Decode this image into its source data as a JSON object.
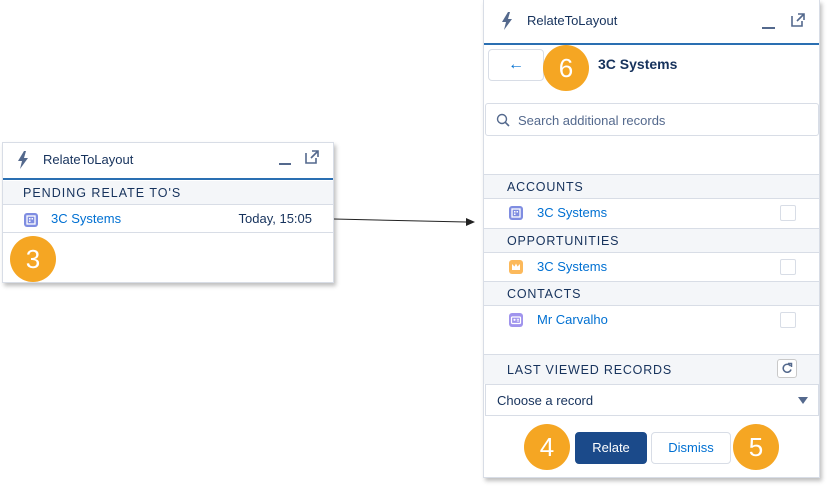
{
  "colors": {
    "accent": "#2a6fb2",
    "link": "#0070d2",
    "badge": "#f5a623",
    "primary_button": "#1b4a8a"
  },
  "left_panel": {
    "title": "RelateToLayout",
    "section": "PENDING RELATE TO'S",
    "item": {
      "name": "3C Systems",
      "time": "Today, 15:05",
      "icon": "account-icon"
    }
  },
  "badges": {
    "b3": "3",
    "b4": "4",
    "b5": "5",
    "b6": "6"
  },
  "right_panel": {
    "title": "RelateToLayout",
    "back_label": "←",
    "record_title": "3C Systems",
    "search_placeholder": "Search additional records",
    "sections": {
      "accounts": {
        "label": "ACCOUNTS",
        "item": "3C Systems",
        "icon": "account-icon"
      },
      "opportunities": {
        "label": "OPPORTUNITIES",
        "item": "3C Systems",
        "icon": "opportunity-icon"
      },
      "contacts": {
        "label": "CONTACTS",
        "item": "Mr Carvalho",
        "icon": "contact-icon"
      }
    },
    "last_viewed": {
      "label": "LAST VIEWED RECORDS",
      "select_value": "Choose a record"
    },
    "buttons": {
      "relate": "Relate",
      "dismiss": "Dismiss"
    }
  }
}
